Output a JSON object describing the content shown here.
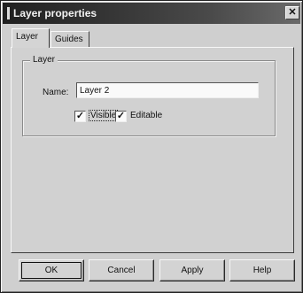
{
  "window": {
    "title": "Layer properties",
    "close_glyph": "✕"
  },
  "tabs": [
    {
      "label": "Layer",
      "active": true
    },
    {
      "label": "Guides",
      "active": false
    }
  ],
  "group": {
    "legend": "Layer",
    "name_label": "Name:",
    "name_value": "Layer 2",
    "visible": {
      "label": "Visible",
      "checked": true
    },
    "editable": {
      "label": "Editable",
      "checked": true
    },
    "check_glyph": "✓"
  },
  "buttons": {
    "ok": "OK",
    "cancel": "Cancel",
    "apply": "Apply",
    "help": "Help"
  }
}
